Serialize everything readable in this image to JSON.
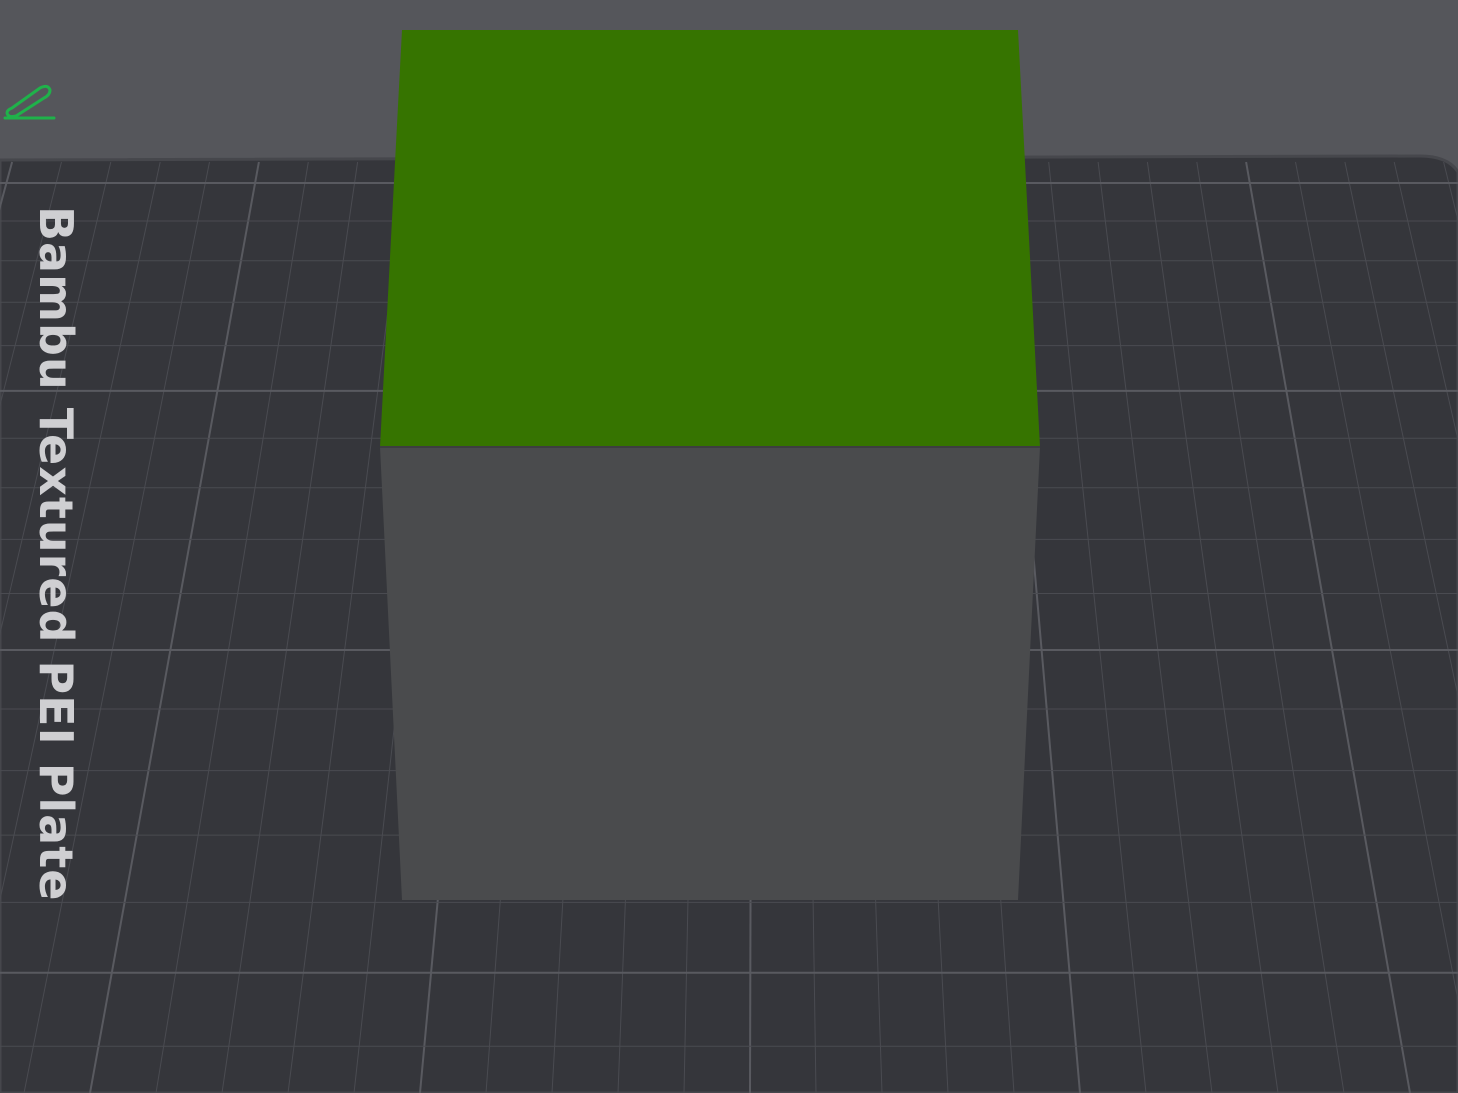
{
  "viewport": {
    "background_color": "#55565b",
    "bed_color": "#35363b",
    "bed_border_color": "#46474c",
    "grid_minor_color": "#4a4b51",
    "grid_major_color": "#595a60"
  },
  "plate": {
    "name": "Bambu Textured PEI Plate",
    "label_color": "#cfcfd2",
    "edit_icon": "pencil-icon",
    "edit_icon_color": "#1fb24a"
  },
  "model": {
    "top_face_color": "#367400",
    "side_face_color": "#4a4b4d",
    "shape": "cube"
  }
}
